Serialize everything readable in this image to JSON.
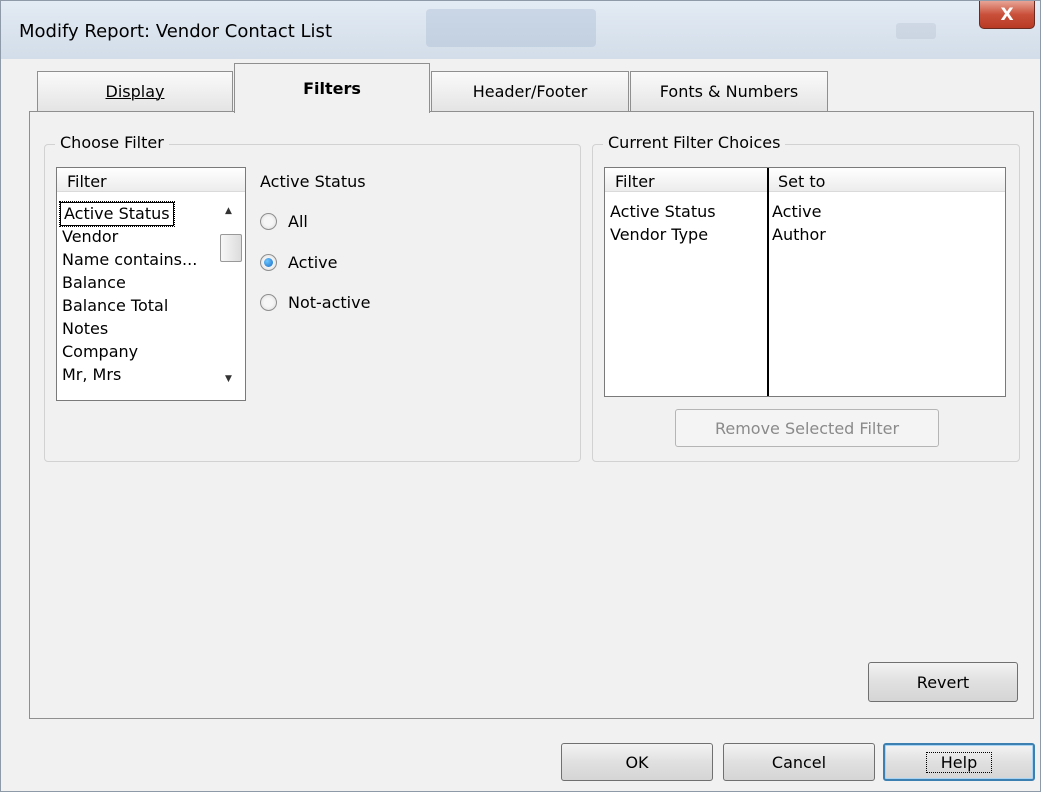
{
  "window": {
    "title": "Modify Report: Vendor Contact List",
    "close_label": "X"
  },
  "tabs": [
    {
      "label": "Display",
      "mnemonic_index": 0
    },
    {
      "label": "Filters",
      "mnemonic_index": 0
    },
    {
      "label": "Header/Footer",
      "mnemonic_index": 0
    },
    {
      "label": "Fonts & Numbers",
      "mnemonic_index": 2
    }
  ],
  "active_tab": "Filters",
  "choose_filter": {
    "group_label": "Choose Filter",
    "list_header": "Filter",
    "items": [
      "Active Status",
      "Vendor",
      "Name contains...",
      "Balance",
      "Balance Total",
      "Notes",
      "Company",
      "Mr, Mrs"
    ],
    "selected": "Active Status"
  },
  "active_status": {
    "label": "Active Status",
    "options": [
      {
        "label": "All",
        "checked": false
      },
      {
        "label": "Active",
        "checked": true
      },
      {
        "label": "Not-active",
        "checked": false
      }
    ]
  },
  "current_filters": {
    "group_label": "Current Filter Choices",
    "col_filter": "Filter",
    "col_set_to": "Set to",
    "rows": [
      {
        "filter": "Active Status",
        "set_to": "Active"
      },
      {
        "filter": "Vendor Type",
        "set_to": "Author"
      }
    ],
    "remove_button": "Remove Selected Filter"
  },
  "buttons": {
    "revert": "Revert",
    "ok": "OK",
    "cancel": "Cancel",
    "help": "Help"
  }
}
